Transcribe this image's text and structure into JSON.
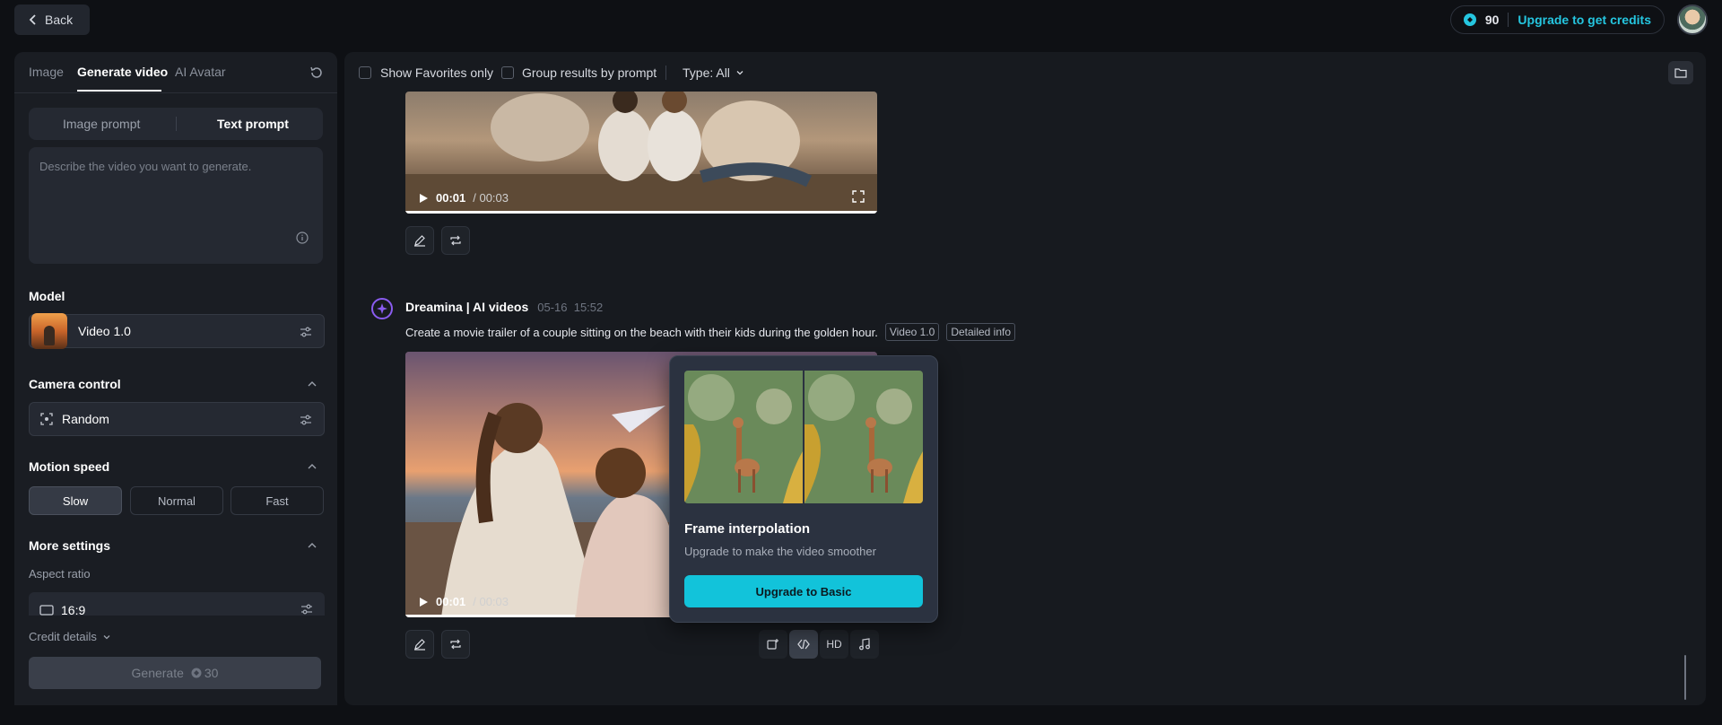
{
  "topbar": {
    "back_label": "Back",
    "credits": "90",
    "upgrade_label": "Upgrade to get credits"
  },
  "left": {
    "tabs": [
      {
        "label": "Image"
      },
      {
        "label": "Generate video"
      },
      {
        "label": "AI Avatar"
      }
    ],
    "prompt_modes": [
      "Image prompt",
      "Text prompt"
    ],
    "prompt_placeholder": "Describe the video you want to generate.",
    "model": {
      "title": "Model",
      "value": "Video 1.0"
    },
    "camera": {
      "title": "Camera control",
      "value": "Random"
    },
    "motion": {
      "title": "Motion speed",
      "options": [
        "Slow",
        "Normal",
        "Fast"
      ],
      "selected": "Slow"
    },
    "more": {
      "title": "More settings",
      "aspect_label": "Aspect ratio",
      "aspect_value": "16:9"
    },
    "credit_details": "Credit details",
    "generate": {
      "label": "Generate",
      "cost": "30"
    }
  },
  "filters": {
    "favorites_label": "Show Favorites only",
    "group_label": "Group results by prompt",
    "type_label": "Type: All"
  },
  "videos": [
    {
      "current": "00:01",
      "duration": "/ 00:03",
      "progress": 1.0
    },
    {
      "current": "00:01",
      "duration": "/ 00:03",
      "progress": 0.36
    }
  ],
  "message": {
    "sender": "Dreamina | AI videos",
    "date": "05-16",
    "time": "15:52",
    "prompt": "Create a movie trailer of a couple sitting on the beach with their kids during the golden hour.",
    "tags": [
      "Video 1.0",
      "Detailed info"
    ]
  },
  "popover": {
    "title": "Frame interpolation",
    "subtitle": "Upgrade to make the video smoother",
    "button": "Upgrade to Basic"
  },
  "actions": {
    "hd_label": "HD"
  },
  "colors": {
    "accent": "#12c3da",
    "bot": "#8a5cf0"
  }
}
